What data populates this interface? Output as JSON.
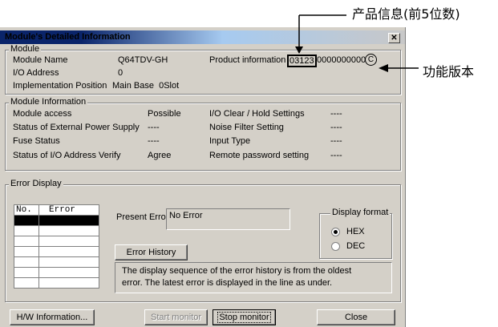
{
  "annotations": {
    "product_info_note": "产品信息(前5位数)",
    "function_version_note": "功能版本"
  },
  "window": {
    "title": "Module's Detailed Information",
    "close_glyph": "✕"
  },
  "module": {
    "legend": "Module",
    "name_label": "Module Name",
    "name_value": "Q64TDV-GH",
    "product_info_label": "Product information",
    "product_info_prefix": "03123",
    "product_info_rest": "0000000000",
    "function_version": "C",
    "io_label": "I/O Address",
    "io_value": "0",
    "impl_label": "Implementation Position",
    "impl_value": "Main Base  0Slot"
  },
  "module_information": {
    "legend": "Module Information",
    "rows": [
      {
        "label": "Module access",
        "value": "Possible",
        "label2": "I/O Clear / Hold Settings",
        "value2": "----"
      },
      {
        "label": "Status of External Power Supply",
        "value": "----",
        "label2": "Noise Filter Setting",
        "value2": "----"
      },
      {
        "label": "Fuse Status",
        "value": "----",
        "label2": "Input Type",
        "value2": "----"
      },
      {
        "label": "Status of I/O Address Verify",
        "value": "Agree",
        "label2": "Remote password setting",
        "value2": "----"
      }
    ]
  },
  "error_display": {
    "legend": "Error Display",
    "col_no": "No.",
    "col_error": "Error",
    "present_error_label": "Present Error",
    "present_error_value": "No Error",
    "error_history_button": "Error History",
    "note_line1": "The display sequence of the error history is from the oldest",
    "note_line2": "error. The latest error is displayed in the line as under.",
    "display_format_legend": "Display format",
    "hex_label": "HEX",
    "dec_label": "DEC",
    "selected_format": "HEX"
  },
  "buttons": {
    "hw_info": "H/W Information...",
    "start_monitor": "Start monitor",
    "stop_monitor": "Stop monitor",
    "close": "Close"
  }
}
